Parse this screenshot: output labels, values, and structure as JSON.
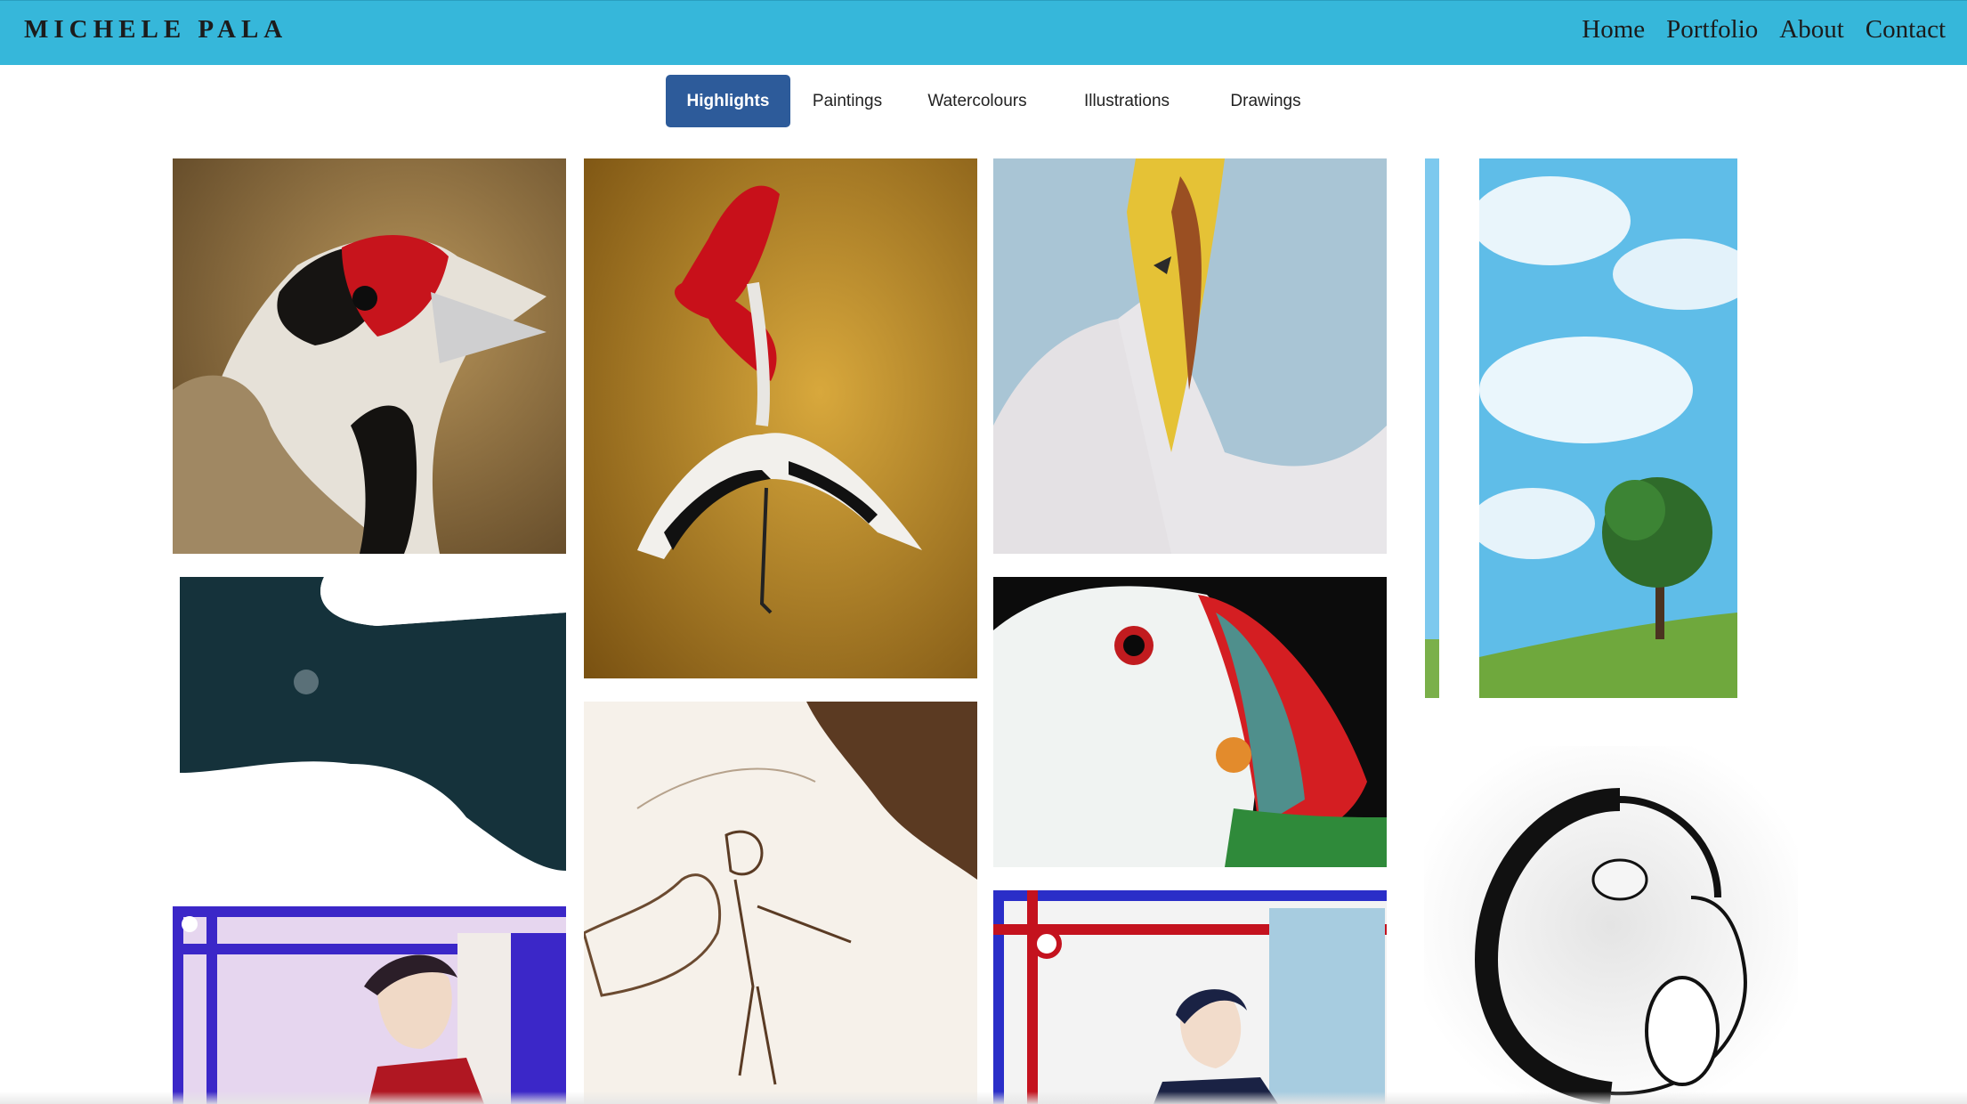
{
  "header": {
    "brand": "MICHELE PALA",
    "nav": [
      "Home",
      "Portfolio",
      "About",
      "Contact"
    ],
    "background_color": "#36b7da"
  },
  "tabs": {
    "items": [
      "Highlights",
      "Paintings",
      "Watercolours",
      "Illustrations",
      "Drawings"
    ],
    "active": "Highlights",
    "active_color": "#2d5b9a"
  },
  "gallery": {
    "items": [
      {
        "subject": "goldfinch painting"
      },
      {
        "subject": "red-crowned crane painting on gold"
      },
      {
        "subject": "gull with open beak painting"
      },
      {
        "subject": "tree on hill watercolour"
      },
      {
        "subject": "dark blue abstract watercolour"
      },
      {
        "subject": "puffin watercolour"
      },
      {
        "subject": "cloaked figure sketch"
      },
      {
        "subject": "ouroboros fish ink drawing"
      },
      {
        "subject": "character illustration purple frame"
      },
      {
        "subject": "character illustration red frame"
      }
    ]
  }
}
